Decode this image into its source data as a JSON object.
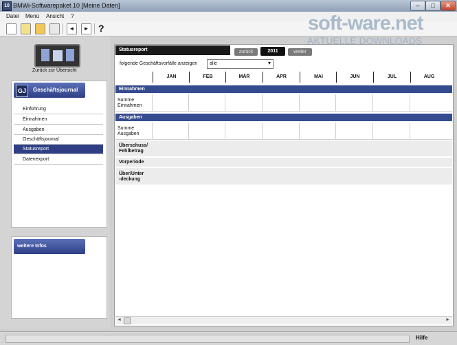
{
  "window": {
    "title": "BMWi-Softwarepaket 10 [Meine Daten]",
    "icon_text": "10",
    "buttons": {
      "minimize": "–",
      "maximize": "□",
      "close": "✕"
    }
  },
  "menu": [
    "Datei",
    "Menü",
    "Ansicht",
    "?"
  ],
  "toolbar": {
    "icons": [
      "new-file-icon",
      "save-icon",
      "open-folder-icon",
      "print-icon",
      "back-icon",
      "forward-icon",
      "help-icon"
    ],
    "help_glyph": "?",
    "arrow_back": "◄",
    "arrow_fwd": "►"
  },
  "watermark": {
    "line1": "soft-ware.net",
    "line2": "AKTUELLE DOWNLOADS"
  },
  "sidebar": {
    "overview_label": "Zurück zur Übersicht",
    "journal_tab": "Geschäftsjournal",
    "journal_icon": "GJ",
    "items": [
      "Einführung",
      "Einnahmen",
      "Ausgaben",
      "Geschäftsjournal",
      "Statusreport",
      "Datenexport"
    ],
    "active_item": "Statusreport",
    "info_tab": "weitere Infos"
  },
  "main": {
    "header": "Statusreport",
    "year_back": "zurück",
    "year": "2011",
    "year_next": "weiter",
    "filter_label": "folgende Geschäftsvorfälle anzeigen",
    "filter_value": "alle",
    "months": [
      "JAN",
      "FEB",
      "MÄR",
      "APR",
      "MAI",
      "JUN",
      "JUL",
      "AUG"
    ],
    "income_section": "Einnahmen",
    "income_row": "Summe\nEinnahmen",
    "expense_section": "Ausgaben",
    "expense_row": "Summe\nAusgaben",
    "summary_rows": [
      "Überschuss/\nFehlbetrag",
      "Vorperiode",
      "Über/Unter\n-deckung"
    ]
  },
  "statusbar": {
    "help": "Hilfe"
  },
  "colors": {
    "accent": "#2e3f86",
    "section": "#344b8f"
  }
}
